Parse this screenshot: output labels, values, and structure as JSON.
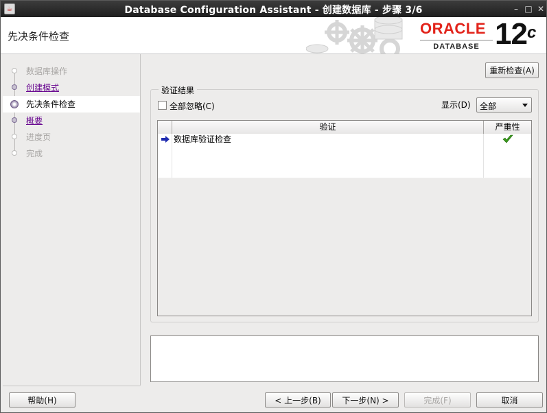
{
  "window": {
    "title": "Database Configuration Assistant - 创建数据库 - 步骤 3/6",
    "controls": {
      "minimize": "–",
      "maximize": "□",
      "close": "✕"
    }
  },
  "header": {
    "heading": "先决条件检查",
    "logo": {
      "brand": "ORACLE",
      "product": "DATABASE",
      "version": "12",
      "version_suffix": "c"
    }
  },
  "nav": {
    "steps": [
      {
        "label": "数据库操作",
        "state": "disabled"
      },
      {
        "label": "创建模式",
        "state": "done"
      },
      {
        "label": "先决条件检查",
        "state": "current"
      },
      {
        "label": "概要",
        "state": "done"
      },
      {
        "label": "进度页",
        "state": "disabled"
      },
      {
        "label": "完成",
        "state": "disabled"
      }
    ]
  },
  "main": {
    "recheck_button": "重新检查(A)",
    "results_group_title": "验证结果",
    "ignore_all_label": "全部忽略(C)",
    "ignore_all_checked": false,
    "show_label": "显示(D)",
    "show_value": "全部",
    "table": {
      "columns": [
        "验证",
        "严重性"
      ],
      "rows": [
        {
          "check": "数据库验证检查",
          "severity_icon": "green-check-icon",
          "selected_icon": "arrow-right-icon"
        }
      ]
    },
    "message_text": ""
  },
  "footer": {
    "help": "帮助(H)",
    "back": "< 上一步(B)",
    "next": "下一步(N) >",
    "finish": "完成(F)",
    "cancel": "取消"
  },
  "colors": {
    "oracle_red": "#e2231a",
    "link_purple": "#6a0a91",
    "arrow_blue": "#1f2bb0",
    "check_green": "#3a9a1c"
  }
}
